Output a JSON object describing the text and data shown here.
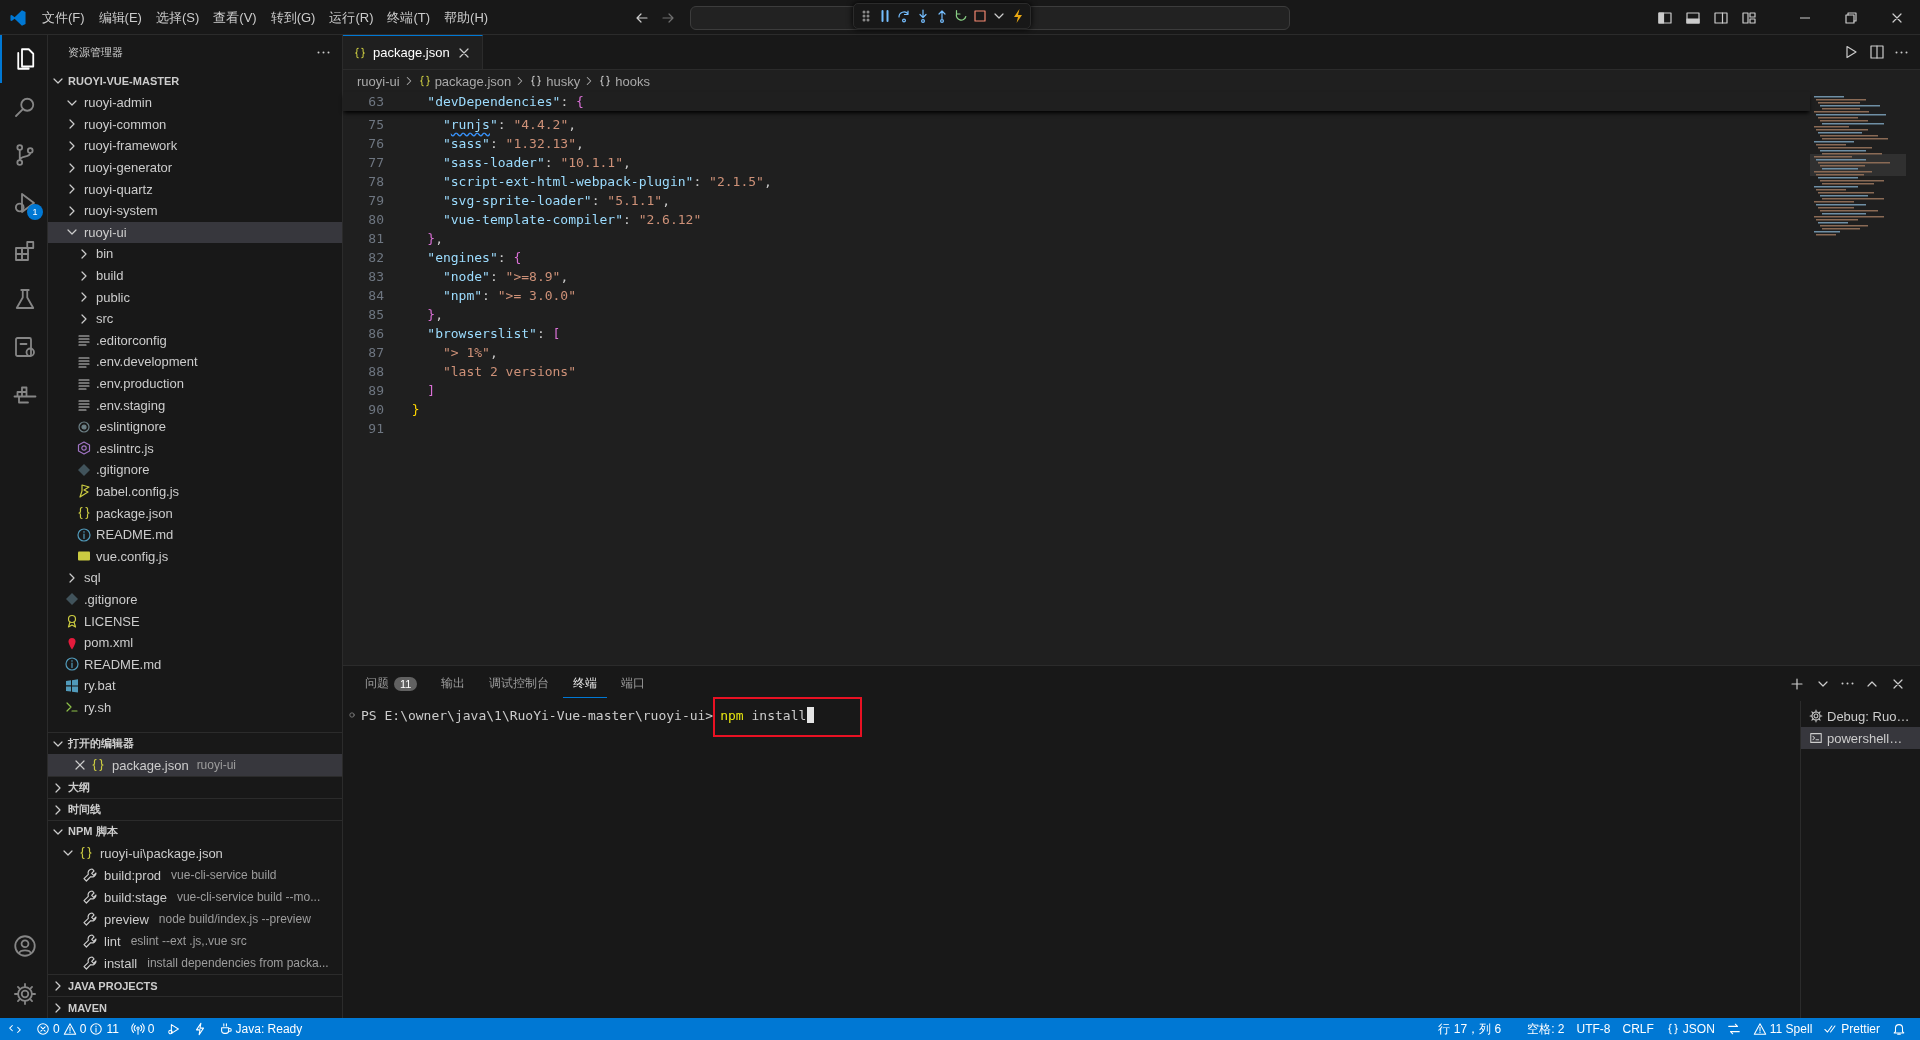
{
  "title_bar": {
    "menu": [
      "文件(F)",
      "编辑(E)",
      "选择(S)",
      "查看(V)",
      "转到(G)",
      "运行(R)",
      "终端(T)",
      "帮助(H)"
    ]
  },
  "activity_bar": {
    "items": [
      {
        "kind": "explorer",
        "selected": true
      },
      {
        "kind": "search",
        "selected": false
      },
      {
        "kind": "source_control",
        "selected": false
      },
      {
        "kind": "run_debug",
        "selected": false,
        "badge": "1"
      },
      {
        "kind": "extensions",
        "selected": false
      },
      {
        "kind": "testing",
        "selected": false
      },
      {
        "kind": "remote",
        "selected": false
      },
      {
        "kind": "containers",
        "selected": false
      }
    ],
    "bottom": [
      {
        "kind": "accounts"
      },
      {
        "kind": "settings"
      }
    ]
  },
  "sidebar": {
    "title": "资源管理器",
    "root": {
      "label": "RUOYI-VUE-MASTER",
      "expanded": true,
      "children": [
        {
          "kind": "folder",
          "label": "ruoyi-admin",
          "expanded": true,
          "selected": false
        },
        {
          "kind": "folder",
          "label": "ruoyi-common",
          "expanded": false,
          "selected": false
        },
        {
          "kind": "folder",
          "label": "ruoyi-framework",
          "expanded": false,
          "selected": false
        },
        {
          "kind": "folder",
          "label": "ruoyi-generator",
          "expanded": false,
          "selected": false
        },
        {
          "kind": "folder",
          "label": "ruoyi-quartz",
          "expanded": false,
          "selected": false
        },
        {
          "kind": "folder",
          "label": "ruoyi-system",
          "expanded": false,
          "selected": false
        },
        {
          "kind": "folder",
          "label": "ruoyi-ui",
          "expanded": true,
          "selected": true,
          "children": [
            {
              "kind": "folder",
              "label": "bin",
              "expanded": false,
              "selected": false
            },
            {
              "kind": "folder",
              "label": "build",
              "expanded": false,
              "selected": false
            },
            {
              "kind": "folder",
              "label": "public",
              "expanded": false,
              "selected": false
            },
            {
              "kind": "folder",
              "label": "src",
              "expanded": false,
              "selected": false
            },
            {
              "kind": "config",
              "label": ".editorconfig",
              "selected": false
            },
            {
              "kind": "config",
              "label": ".env.development",
              "selected": false
            },
            {
              "kind": "config",
              "label": ".env.production",
              "selected": false
            },
            {
              "kind": "config",
              "label": ".env.staging",
              "selected": false
            },
            {
              "kind": "ignore",
              "label": ".eslintignore",
              "selected": false
            },
            {
              "kind": "eslint",
              "label": ".eslintrc.js",
              "selected": false
            },
            {
              "kind": "git",
              "label": ".gitignore",
              "selected": false
            },
            {
              "kind": "babel",
              "label": "babel.config.js",
              "selected": false
            },
            {
              "kind": "json",
              "label": "package.json",
              "selected": false
            },
            {
              "kind": "info",
              "label": "README.md",
              "selected": false
            },
            {
              "kind": "js",
              "label": "vue.config.js",
              "selected": false
            }
          ]
        },
        {
          "kind": "folder",
          "label": "sql",
          "expanded": false,
          "selected": false
        },
        {
          "kind": "git",
          "label": ".gitignore",
          "selected": false
        },
        {
          "kind": "license",
          "label": "LICENSE",
          "selected": false
        },
        {
          "kind": "maven",
          "label": "pom.xml",
          "selected": false
        },
        {
          "kind": "info",
          "label": "README.md",
          "selected": false
        },
        {
          "kind": "windows",
          "label": "ry.bat",
          "selected": false
        },
        {
          "kind": "shell",
          "label": "ry.sh",
          "selected": false
        }
      ]
    },
    "sections": [
      {
        "kind": "open_editors",
        "title": "打开的编辑器",
        "expanded": true,
        "items": [
          {
            "name": "package.json",
            "path": "ruoyi-ui",
            "selected": true
          }
        ]
      },
      {
        "kind": "plain",
        "title": "大纲",
        "expanded": false
      },
      {
        "kind": "plain",
        "title": "时间线",
        "expanded": false
      },
      {
        "kind": "npm",
        "title": "NPM 脚本",
        "expanded": true,
        "package": {
          "name": "ruoyi-ui\\package.json",
          "expanded": true
        },
        "scripts": [
          {
            "name": "build:prod",
            "command": "vue-cli-service build"
          },
          {
            "name": "build:stage",
            "command": "vue-cli-service build --mo..."
          },
          {
            "name": "preview",
            "command": "node build/index.js --preview"
          },
          {
            "name": "lint",
            "command": "eslint --ext .js,.vue src"
          },
          {
            "name": "install",
            "command": "install dependencies from packa..."
          }
        ]
      },
      {
        "kind": "plain",
        "title": "JAVA PROJECTS",
        "expanded": false
      },
      {
        "kind": "plain",
        "title": "MAVEN",
        "expanded": false
      }
    ]
  },
  "editor": {
    "tabs": [
      {
        "label": "package.json",
        "selected": true
      }
    ],
    "breadcrumb": [
      {
        "kind": "folder",
        "text": "ruoyi-ui"
      },
      {
        "kind": "json",
        "text": "package.json"
      },
      {
        "kind": "object",
        "text": "husky"
      },
      {
        "kind": "object",
        "text": "hooks"
      }
    ],
    "sticky_line": {
      "number": "63",
      "tokens": [
        {
          "kind": "key",
          "text": "    \"devDependencies\""
        },
        {
          "kind": "punct",
          "text": ": "
        },
        {
          "kind": "bracket2",
          "text": "{"
        }
      ]
    },
    "lines": [
      {
        "number": "75",
        "tokens": [
          {
            "kind": "key",
            "text": "      \""
          },
          {
            "kind": "key_flagged",
            "text": "runjs"
          },
          {
            "kind": "key",
            "text": "\""
          },
          {
            "kind": "punct",
            "text": ": "
          },
          {
            "kind": "string",
            "text": "\"4.4.2\""
          },
          {
            "kind": "punct",
            "text": ","
          }
        ]
      },
      {
        "number": "76",
        "tokens": [
          {
            "kind": "key",
            "text": "      \"sass\""
          },
          {
            "kind": "punct",
            "text": ": "
          },
          {
            "kind": "string",
            "text": "\"1.32.13\""
          },
          {
            "kind": "punct",
            "text": ","
          }
        ]
      },
      {
        "number": "77",
        "tokens": [
          {
            "kind": "key",
            "text": "      \"sass-loader\""
          },
          {
            "kind": "punct",
            "text": ": "
          },
          {
            "kind": "string",
            "text": "\"10.1.1\""
          },
          {
            "kind": "punct",
            "text": ","
          }
        ]
      },
      {
        "number": "78",
        "tokens": [
          {
            "kind": "key",
            "text": "      \"script-ext-html-webpack-plugin\""
          },
          {
            "kind": "punct",
            "text": ": "
          },
          {
            "kind": "string",
            "text": "\"2.1.5\""
          },
          {
            "kind": "punct",
            "text": ","
          }
        ]
      },
      {
        "number": "79",
        "tokens": [
          {
            "kind": "key",
            "text": "      \"svg-sprite-loader\""
          },
          {
            "kind": "punct",
            "text": ": "
          },
          {
            "kind": "string",
            "text": "\"5.1.1\""
          },
          {
            "kind": "punct",
            "text": ","
          }
        ]
      },
      {
        "number": "80",
        "tokens": [
          {
            "kind": "key",
            "text": "      \"vue-template-compiler\""
          },
          {
            "kind": "punct",
            "text": ": "
          },
          {
            "kind": "string",
            "text": "\"2.6.12\""
          }
        ]
      },
      {
        "number": "81",
        "tokens": [
          {
            "kind": "bracket2",
            "text": "    }"
          },
          {
            "kind": "punct",
            "text": ","
          }
        ]
      },
      {
        "number": "82",
        "tokens": [
          {
            "kind": "key",
            "text": "    \"engines\""
          },
          {
            "kind": "punct",
            "text": ": "
          },
          {
            "kind": "bracket2",
            "text": "{"
          }
        ]
      },
      {
        "number": "83",
        "tokens": [
          {
            "kind": "key",
            "text": "      \"node\""
          },
          {
            "kind": "punct",
            "text": ": "
          },
          {
            "kind": "string",
            "text": "\">=8.9\""
          },
          {
            "kind": "punct",
            "text": ","
          }
        ]
      },
      {
        "number": "84",
        "tokens": [
          {
            "kind": "key",
            "text": "      \"npm\""
          },
          {
            "kind": "punct",
            "text": ": "
          },
          {
            "kind": "string",
            "text": "\">= 3.0.0\""
          }
        ]
      },
      {
        "number": "85",
        "tokens": [
          {
            "kind": "bracket2",
            "text": "    }"
          },
          {
            "kind": "punct",
            "text": ","
          }
        ]
      },
      {
        "number": "86",
        "tokens": [
          {
            "kind": "key",
            "text": "    \"browserslist\""
          },
          {
            "kind": "punct",
            "text": ": "
          },
          {
            "kind": "bracket2",
            "text": "["
          }
        ]
      },
      {
        "number": "87",
        "tokens": [
          {
            "kind": "string",
            "text": "      \"> 1%\""
          },
          {
            "kind": "punct",
            "text": ","
          }
        ]
      },
      {
        "number": "88",
        "tokens": [
          {
            "kind": "string",
            "text": "      \"last 2 versions\""
          }
        ]
      },
      {
        "number": "89",
        "tokens": [
          {
            "kind": "bracket2",
            "text": "    ]"
          }
        ]
      },
      {
        "number": "90",
        "tokens": [
          {
            "kind": "bracket1",
            "text": "  }"
          }
        ]
      },
      {
        "number": "91"
      }
    ]
  },
  "panel": {
    "tabs": [
      {
        "label": "问题",
        "badge": "11",
        "selected": false
      },
      {
        "label": "输出",
        "selected": false
      },
      {
        "label": "调试控制台",
        "selected": false
      },
      {
        "label": "终端",
        "selected": true
      },
      {
        "label": "端口",
        "selected": false
      }
    ],
    "terminal": {
      "prompt": "PS E:\\owner\\java\\1\\RuoYi-Vue-master\\ruoyi-ui>",
      "command": "npm",
      "argument": "install",
      "highlighted": true
    },
    "instances": [
      {
        "kind": "debug",
        "label": "Debug: Ruo…",
        "selected": false
      },
      {
        "kind": "shell",
        "label": "powershell…",
        "selected": true
      }
    ]
  },
  "status_bar": {
    "left": [
      {
        "kind": "remote"
      },
      {
        "kind": "problems",
        "errors": "0",
        "warnings": "0",
        "infos": "11"
      },
      {
        "kind": "ports",
        "text": "0"
      },
      {
        "kind": "debug"
      },
      {
        "kind": "lightning"
      },
      {
        "kind": "java",
        "text": "Java: Ready"
      }
    ],
    "right": [
      {
        "kind": "position",
        "text": "行 17，列 6"
      },
      {
        "kind": "indent",
        "text": "空格: 2"
      },
      {
        "kind": "encoding",
        "text": "UTF-8"
      },
      {
        "kind": "eol",
        "text": "CRLF"
      },
      {
        "kind": "language",
        "text": "JSON"
      },
      {
        "kind": "feedback"
      },
      {
        "kind": "spell",
        "text": "11 Spell"
      },
      {
        "kind": "formatter",
        "text": "Prettier"
      },
      {
        "kind": "notifications"
      }
    ]
  }
}
